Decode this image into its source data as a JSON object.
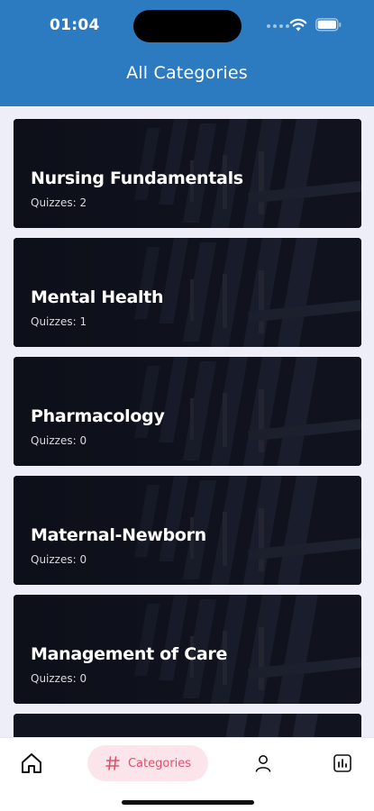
{
  "status_bar": {
    "time": "01:04"
  },
  "header": {
    "title": "All Categories"
  },
  "categories": [
    {
      "title": "Nursing Fundamentals",
      "quizzes_label": "Quizzes: 2"
    },
    {
      "title": "Mental Health",
      "quizzes_label": "Quizzes: 1"
    },
    {
      "title": "Pharmacology",
      "quizzes_label": "Quizzes: 0"
    },
    {
      "title": "Maternal-Newborn",
      "quizzes_label": "Quizzes: 0"
    },
    {
      "title": "Management of Care",
      "quizzes_label": "Quizzes: 0"
    }
  ],
  "tabbar": {
    "home_icon": "home-icon",
    "categories_label": "Categories",
    "categories_icon": "hashtag-icon",
    "profile_icon": "user-icon",
    "stats_icon": "bar-chart-icon"
  },
  "colors": {
    "header": "#2c7bc0",
    "background": "#eeeef9",
    "card": "#0f111c",
    "active_tab_bg": "#fbe5ea",
    "active_tab_fg": "#e0506e"
  }
}
